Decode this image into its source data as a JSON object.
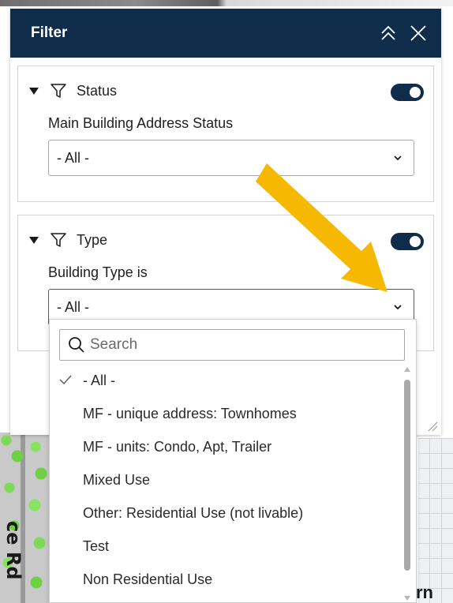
{
  "panel": {
    "title": "Filter"
  },
  "status_filter": {
    "title": "Status",
    "enabled": true,
    "field_label": "Main Building Address Status",
    "selected": "- All -"
  },
  "type_filter": {
    "title": "Type",
    "enabled": true,
    "field_label": "Building Type is",
    "selected": "- All -"
  },
  "dropdown": {
    "search_placeholder": "Search",
    "options": [
      {
        "label": "- All -",
        "checked": true
      },
      {
        "label": "MF - unique address: Townhomes",
        "checked": false
      },
      {
        "label": "MF - units: Condo, Apt, Trailer",
        "checked": false
      },
      {
        "label": "Mixed Use",
        "checked": false
      },
      {
        "label": "Other: Residential Use (not livable)",
        "checked": false
      },
      {
        "label": "Test",
        "checked": false
      },
      {
        "label": "Non Residential Use",
        "checked": false
      }
    ]
  },
  "map": {
    "left_label": "ce Rd",
    "right_label": "rn"
  },
  "colors": {
    "header_bg": "#0f2d4a",
    "toggle_on": "#0f2d4a",
    "annotation_arrow": "#f6b800"
  }
}
